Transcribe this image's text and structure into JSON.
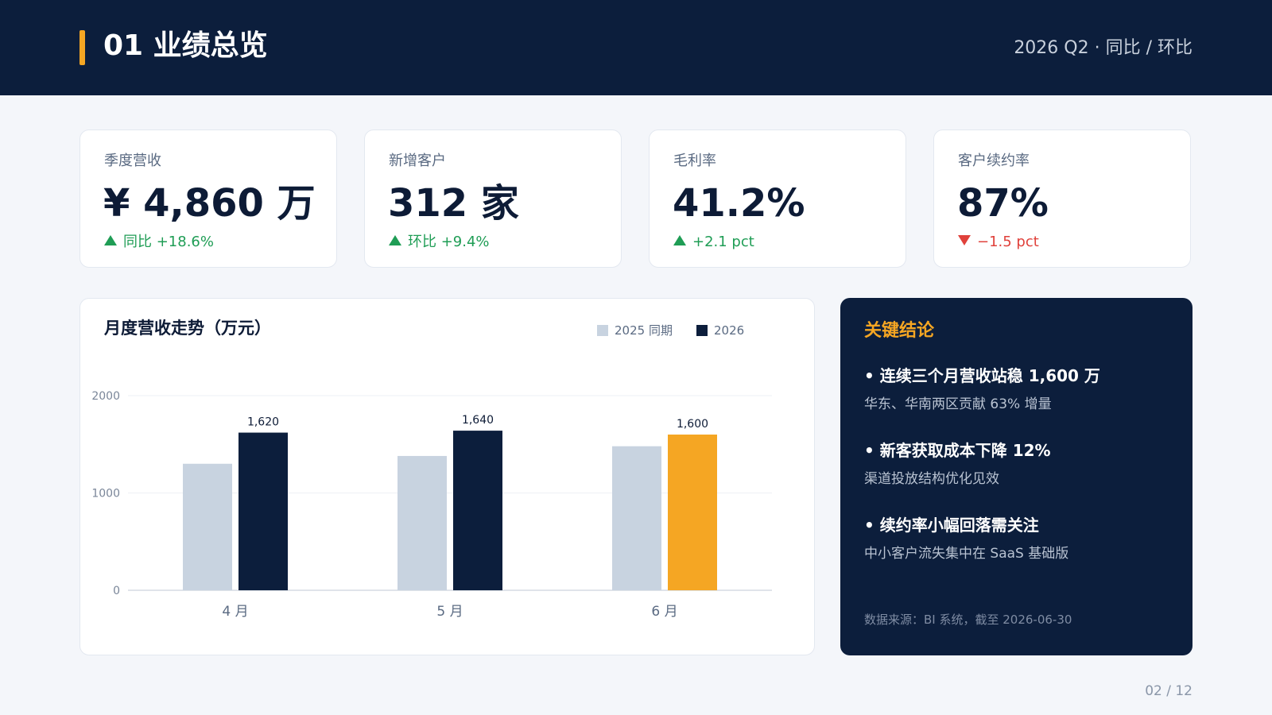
{
  "header": {
    "title": "01 业绩总览",
    "period": "2026 Q2 · 同比 / 环比"
  },
  "kpis": [
    {
      "label": "季度营收",
      "value": "¥ 4,860 万",
      "delta": "同比 +18.6%",
      "trend": "up"
    },
    {
      "label": "新增客户",
      "value": "312 家",
      "delta": "环比 +9.4%",
      "trend": "up"
    },
    {
      "label": "毛利率",
      "value": "41.2%",
      "delta": "+2.1 pct",
      "trend": "up"
    },
    {
      "label": "客户续约率",
      "value": "87%",
      "delta": "−1.5 pct",
      "trend": "down"
    }
  ],
  "chart_data": {
    "type": "bar",
    "title": "月度营收走势（万元）",
    "categories": [
      "4 月",
      "5 月",
      "6 月"
    ],
    "series": [
      {
        "name": "2025 同期",
        "values": [
          1300,
          1380,
          1480
        ],
        "color": "#c8d3e0"
      },
      {
        "name": "2026",
        "values": [
          1620,
          1640,
          1600
        ],
        "color": "#0c1e3c",
        "highlight_color": "#f5a623",
        "highlight_index": 2,
        "labels": [
          "1,620",
          "1,640",
          "1,600"
        ]
      }
    ],
    "ylim": [
      0,
      2000
    ],
    "yticks": [
      0,
      1000,
      2000
    ],
    "grid": true,
    "legend": "top-right",
    "xlabel": "",
    "ylabel": ""
  },
  "conclusions": {
    "title": "关键结论",
    "items": [
      {
        "point": "• 连续三个月营收站稳 1,600 万",
        "detail": "华东、华南两区贡献 63% 增量"
      },
      {
        "point": "• 新客获取成本下降 12%",
        "detail": "渠道投放结构优化见效"
      },
      {
        "point": "• 续约率小幅回落需关注",
        "detail": "中小客户流失集中在 SaaS 基础版"
      }
    ],
    "source": "数据来源：BI 系统，截至 2026-06-30"
  },
  "pager": "02 / 12",
  "colors": {
    "navy": "#0c1e3c",
    "accent": "#f5a623",
    "up": "#1f9d55",
    "down": "#e0413b",
    "prev_bar": "#c8d3e0"
  }
}
